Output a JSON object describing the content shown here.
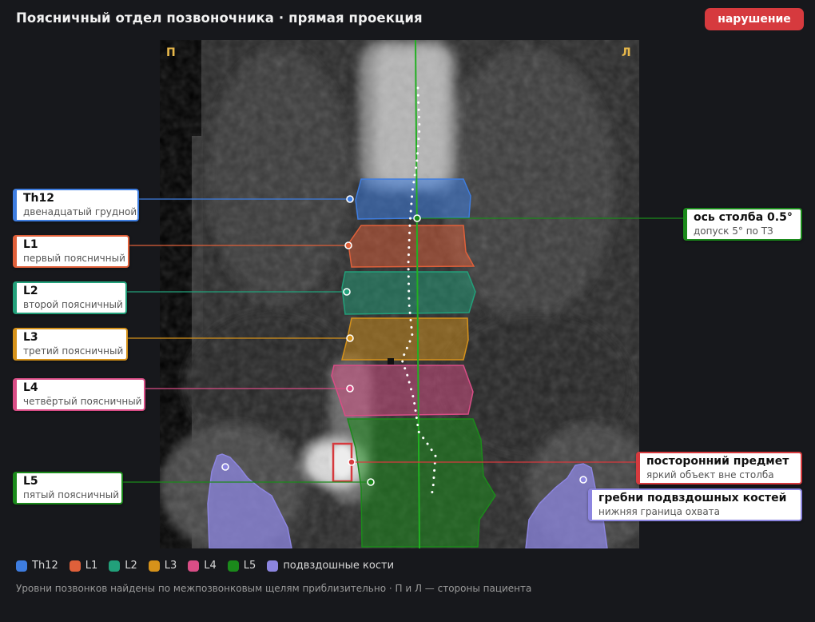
{
  "header": {
    "title": "Поясничный отдел позвоночника · прямая проекция",
    "status_badge": "нарушение",
    "status_color": "#d63a3e"
  },
  "viewer": {
    "orient_left": "П",
    "orient_right": "Л",
    "orient_color": "#e8b84a"
  },
  "vertebrae": [
    {
      "id": "th12",
      "name": "Th12",
      "desc": "двенадцатый грудной",
      "color": "#3e7de0"
    },
    {
      "id": "l1",
      "name": "L1",
      "desc": "первый поясничный",
      "color": "#e0603a"
    },
    {
      "id": "l2",
      "name": "L2",
      "desc": "второй поясничный",
      "color": "#22a07a"
    },
    {
      "id": "l3",
      "name": "L3",
      "desc": "третий поясничный",
      "color": "#d6921a"
    },
    {
      "id": "l4",
      "name": "L4",
      "desc": "четвёртый поясничный",
      "color": "#d94d86"
    },
    {
      "id": "l5",
      "name": "L5",
      "desc": "пятый поясничный",
      "color": "#1b8a1b"
    }
  ],
  "annotations": {
    "axis": {
      "name": "ось столба 0.5°",
      "desc": "допуск 5° по ТЗ",
      "color": "#1b8a1b"
    },
    "foreign": {
      "name": "посторонний предмет",
      "desc": "яркий объект вне столба",
      "color": "#d63a3e"
    },
    "iliac": {
      "name": "гребни подвздошных костей",
      "desc": "нижняя граница охвата",
      "color": "#8c85e0"
    }
  },
  "legend": [
    {
      "label": "Th12",
      "color": "#3e7de0"
    },
    {
      "label": "L1",
      "color": "#e0603a"
    },
    {
      "label": "L2",
      "color": "#22a07a"
    },
    {
      "label": "L3",
      "color": "#d6921a"
    },
    {
      "label": "L4",
      "color": "#d94d86"
    },
    {
      "label": "L5",
      "color": "#1b8a1b"
    },
    {
      "label": "подвздошные кости",
      "color": "#8c85e0"
    }
  ],
  "footnote": "Уровни позвонков найдены по межпозвонковым щелям приблизительно · П и Л — стороны пациента"
}
